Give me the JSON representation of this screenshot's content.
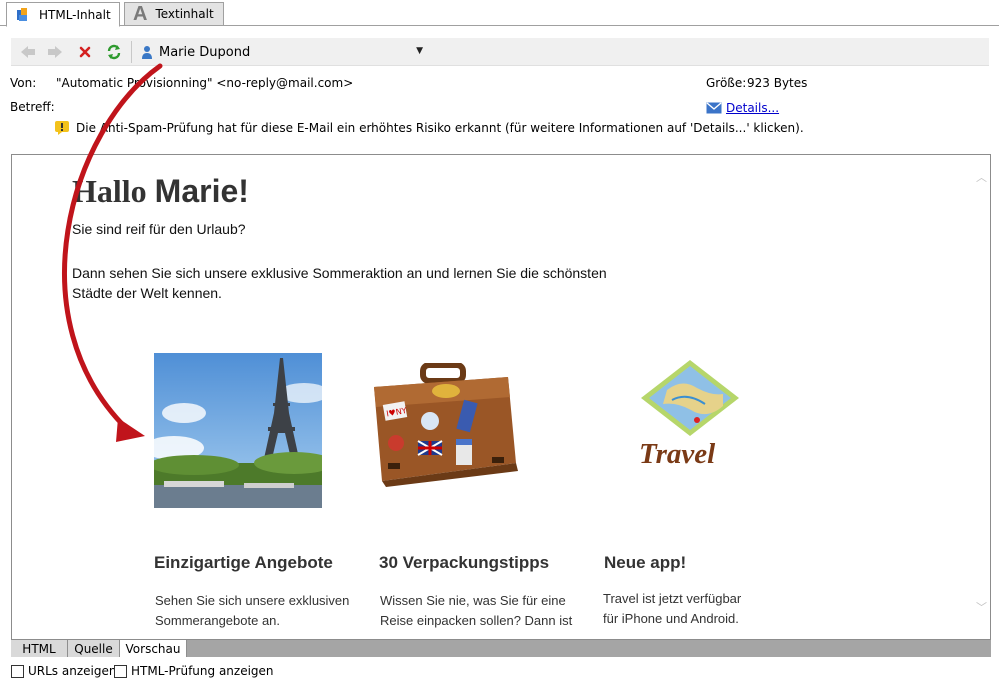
{
  "tabs": [
    {
      "label": "HTML-Inhalt"
    },
    {
      "label": "Textinhalt"
    }
  ],
  "toolbar": {
    "recipient": "Marie Dupond"
  },
  "header": {
    "from_label": "Von:",
    "from_value": "\"Automatic Provisionning\" <no-reply@mail.com>",
    "subject_label": "Betreff:",
    "size_label": "Größe:",
    "size_value": "923 Bytes",
    "details_link": "Details...",
    "spam_warning": "Die Anti-Spam-Prüfung hat für diese E-Mail ein erhöhtes Risiko erkannt (für weitere Informationen auf 'Details...' klicken)."
  },
  "email": {
    "greeting_word": "Hallo",
    "greeting_name": "Marie!",
    "intro": "Sie sind reif für den Urlaub?",
    "body_line1": "Dann sehen Sie sich unsere exklusive Sommeraktion an und lernen Sie die schönsten",
    "body_line2": "Städte der Welt kennen.",
    "columns": [
      {
        "title": "Einzigartige Angebote",
        "text1": "Sehen Sie sich unsere exklusiven",
        "text2": "Sommerangebote an."
      },
      {
        "title": "30 Verpackungstipps",
        "text1": "Wissen Sie nie, was Sie für eine",
        "text2": "Reise einpacken sollen? Dann ist"
      },
      {
        "title": "Neue app!",
        "text1": "Travel ist jetzt verfügbar",
        "text2": "für iPhone und Android."
      }
    ],
    "travel_logo_text": "Travel"
  },
  "bottom_tabs": [
    {
      "label": "HTML"
    },
    {
      "label": "Quelle"
    },
    {
      "label": "Vorschau"
    }
  ],
  "options": {
    "show_urls": "URLs anzeigen",
    "show_html_check": "HTML-Prüfung anzeigen"
  },
  "colors": {
    "arrow": "#c0141b",
    "tab_active_bg": "#ffffff",
    "link": "#0000cc"
  }
}
